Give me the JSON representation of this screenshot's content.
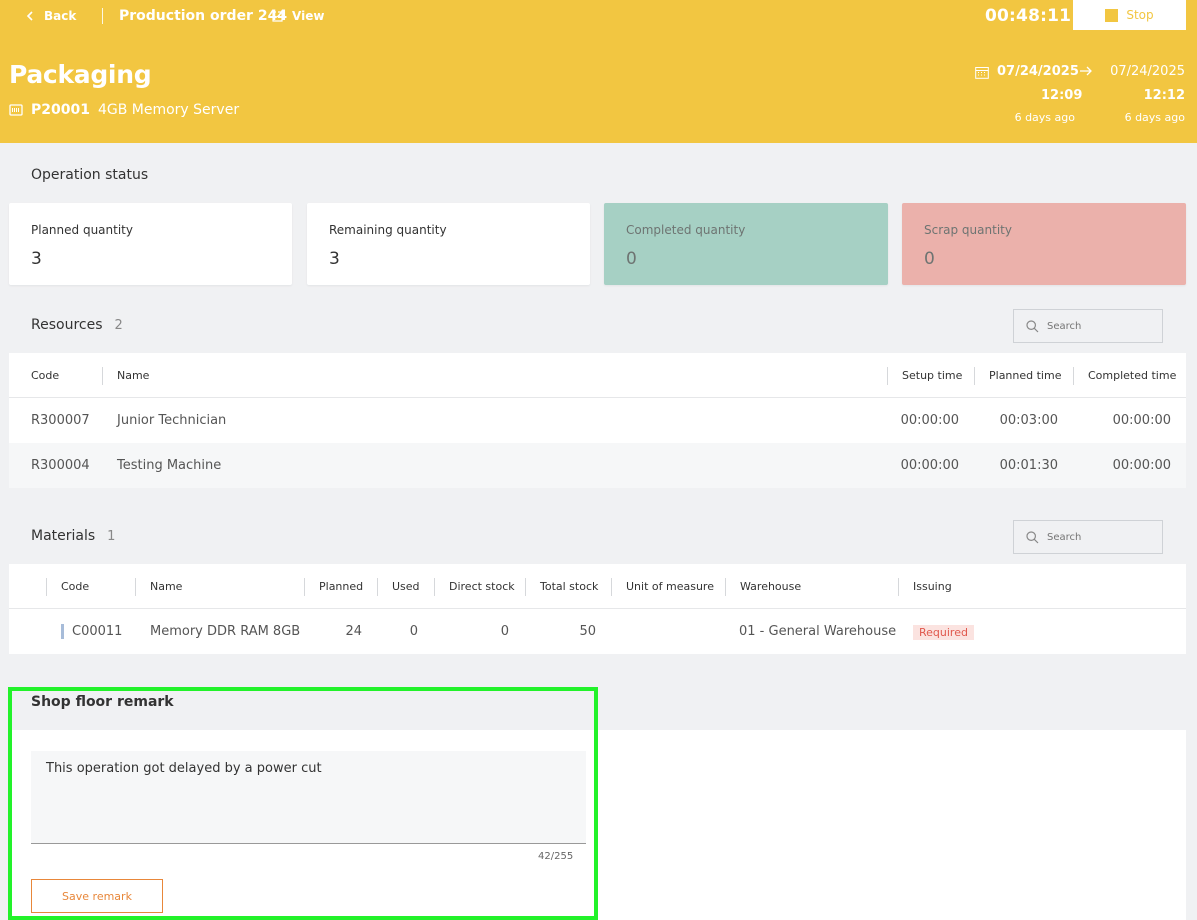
{
  "header": {
    "back_label": "Back",
    "production_order": "Production order 244",
    "view_label": "View",
    "timer": "00:48:11",
    "stop_label": "Stop",
    "operation_title": "Packaging",
    "product_code": "P20001",
    "product_name": "4GB Memory Server",
    "start_date": "07/24/2025",
    "end_date": "07/24/2025",
    "start_time": "12:09",
    "end_time": "12:12",
    "start_ago": "6 days ago",
    "end_ago": "6 days ago"
  },
  "operation_status": {
    "title": "Operation status",
    "cards": [
      {
        "label": "Planned quantity",
        "value": "3"
      },
      {
        "label": "Remaining quantity",
        "value": "3"
      },
      {
        "label": "Completed quantity",
        "value": "0"
      },
      {
        "label": "Scrap quantity",
        "value": "0"
      }
    ]
  },
  "resources": {
    "title": "Resources",
    "count": "2",
    "search_placeholder": "Search",
    "columns": [
      "Code",
      "Name",
      "Setup time",
      "Planned time",
      "Completed time"
    ],
    "rows": [
      {
        "code": "R300007",
        "name": "Junior Technician",
        "setup": "00:00:00",
        "planned": "00:03:00",
        "completed": "00:00:00"
      },
      {
        "code": "R300004",
        "name": "Testing Machine",
        "setup": "00:00:00",
        "planned": "00:01:30",
        "completed": "00:00:00"
      }
    ]
  },
  "materials": {
    "title": "Materials",
    "count": "1",
    "search_placeholder": "Search",
    "columns": [
      "Code",
      "Name",
      "Planned",
      "Used",
      "Direct stock",
      "Total stock",
      "Unit of measure",
      "Warehouse",
      "Issuing"
    ],
    "rows": [
      {
        "code": "C00011",
        "name": "Memory DDR RAM 8GB",
        "planned": "24",
        "used": "0",
        "direct_stock": "0",
        "total_stock": "50",
        "uom": "",
        "warehouse": "01 - General Warehouse",
        "issuing": "Required"
      }
    ]
  },
  "remark": {
    "title": "Shop floor remark",
    "value": "This operation got delayed by a power cut",
    "char_count": "42/255",
    "save_label": "Save remark"
  }
}
